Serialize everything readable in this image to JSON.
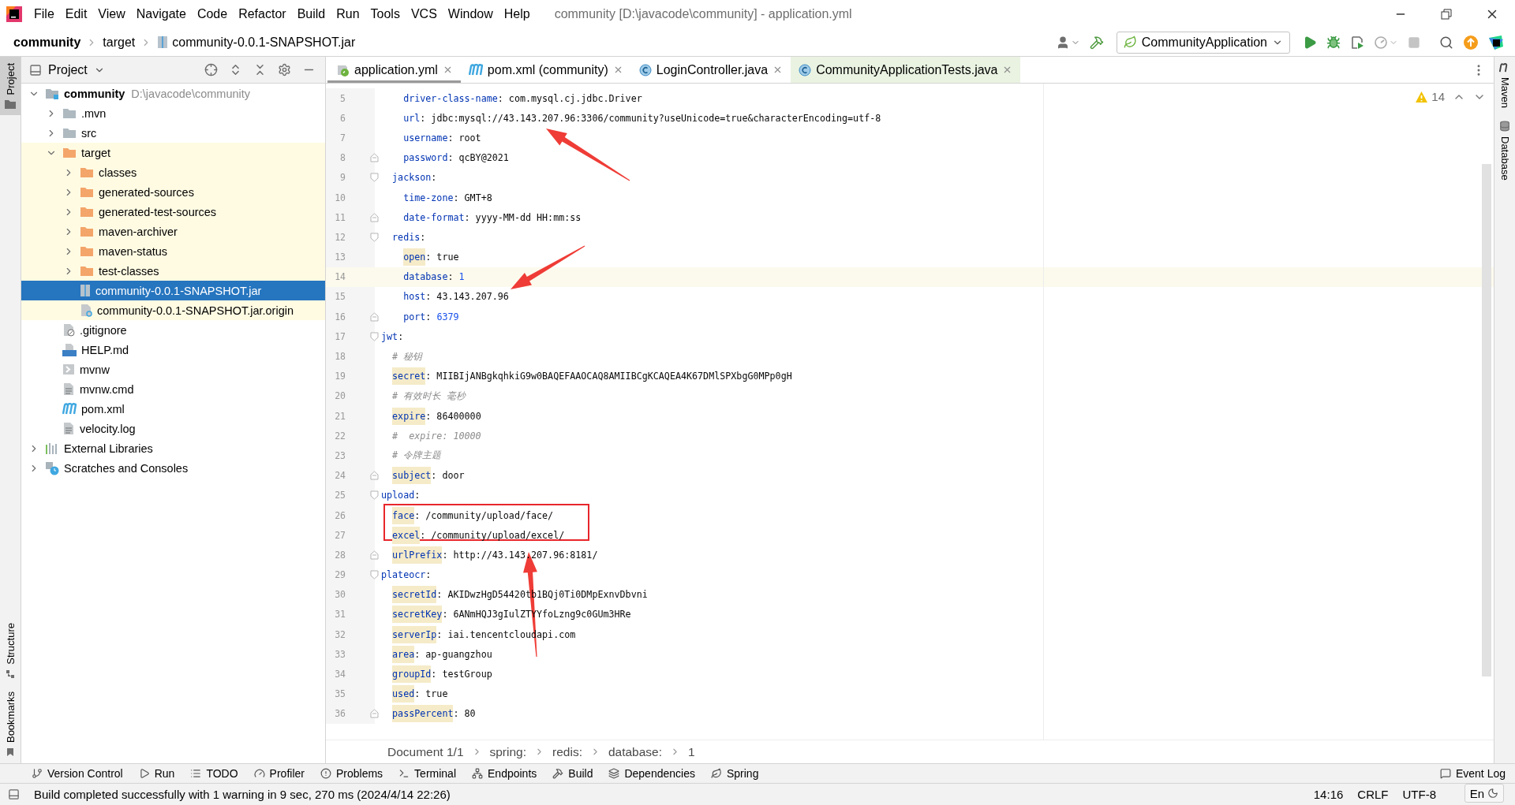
{
  "window": {
    "title": "community [D:\\javacode\\community] - application.yml"
  },
  "menu": [
    "File",
    "Edit",
    "View",
    "Navigate",
    "Code",
    "Refactor",
    "Build",
    "Run",
    "Tools",
    "VCS",
    "Window",
    "Help"
  ],
  "breadcrumbs": [
    "community",
    "target",
    "community-0.0.1-SNAPSHOT.jar"
  ],
  "run_config": {
    "label": "CommunityApplication"
  },
  "left_strip": {
    "top": [
      {
        "label": "Project",
        "selected": true
      }
    ],
    "bottom": [
      {
        "label": "Structure",
        "selected": false
      },
      {
        "label": "Bookmarks",
        "selected": false
      }
    ]
  },
  "project_panel": {
    "title": "Project",
    "tree": [
      {
        "label": "community",
        "path": "D:\\javacode\\community",
        "kind": "module",
        "expanded": true,
        "selected": false,
        "excluded": false,
        "children": [
          {
            "label": ".mvn",
            "kind": "folder",
            "expanded": false,
            "selected": false,
            "excluded": false
          },
          {
            "label": "src",
            "kind": "folder",
            "expanded": false,
            "selected": false,
            "excluded": false
          },
          {
            "label": "target",
            "kind": "folder",
            "expanded": true,
            "selected": false,
            "excluded": true,
            "children": [
              {
                "label": "classes",
                "kind": "folder",
                "expanded": false,
                "selected": false,
                "excluded": true
              },
              {
                "label": "generated-sources",
                "kind": "folder",
                "expanded": false,
                "selected": false,
                "excluded": true
              },
              {
                "label": "generated-test-sources",
                "kind": "folder",
                "expanded": false,
                "selected": false,
                "excluded": true
              },
              {
                "label": "maven-archiver",
                "kind": "folder",
                "expanded": false,
                "selected": false,
                "excluded": true
              },
              {
                "label": "maven-status",
                "kind": "folder",
                "expanded": false,
                "selected": false,
                "excluded": true
              },
              {
                "label": "test-classes",
                "kind": "folder",
                "expanded": false,
                "selected": false,
                "excluded": true
              },
              {
                "label": "community-0.0.1-SNAPSHOT.jar",
                "kind": "jar",
                "selected": true,
                "excluded": true
              },
              {
                "label": "community-0.0.1-SNAPSHOT.jar.origin",
                "kind": "unknown",
                "selected": false,
                "excluded": true
              }
            ]
          },
          {
            "label": ".gitignore",
            "kind": "ignore",
            "selected": false,
            "excluded": false
          },
          {
            "label": "HELP.md",
            "kind": "markdown",
            "selected": false,
            "excluded": false
          },
          {
            "label": "mvnw",
            "kind": "shell",
            "selected": false,
            "excluded": false
          },
          {
            "label": "mvnw.cmd",
            "kind": "text",
            "selected": false,
            "excluded": false
          },
          {
            "label": "pom.xml",
            "kind": "maven",
            "selected": false,
            "excluded": false
          },
          {
            "label": "velocity.log",
            "kind": "text",
            "selected": false,
            "excluded": false
          }
        ]
      },
      {
        "label": "External Libraries",
        "kind": "libraries",
        "expanded": false,
        "selected": false,
        "excluded": false
      },
      {
        "label": "Scratches and Consoles",
        "kind": "scratches",
        "expanded": false,
        "selected": false,
        "excluded": false
      }
    ]
  },
  "tabs": [
    {
      "label": "application.yml",
      "kind": "yaml",
      "selected": true,
      "test": false
    },
    {
      "label": "pom.xml (community)",
      "kind": "maven",
      "selected": false,
      "test": false
    },
    {
      "label": "LoginController.java",
      "kind": "class",
      "selected": false,
      "test": false
    },
    {
      "label": "CommunityApplicationTests.java",
      "kind": "class",
      "selected": false,
      "test": true
    }
  ],
  "editor": {
    "warnings": "14",
    "lines": [
      {
        "number": "5",
        "kind": "deep",
        "fold_open": false,
        "fold_close": false,
        "tokens": [
          {
            "kind": "key",
            "text": "driver-class-name",
            "flagged": false
          },
          {
            "kind": "plain",
            "text": ": com.mysql.cj.jdbc.Driver"
          }
        ]
      },
      {
        "number": "6",
        "kind": "deep",
        "fold_open": false,
        "fold_close": false,
        "tokens": [
          {
            "kind": "key",
            "text": "url",
            "flagged": false
          },
          {
            "kind": "plain",
            "text": ": jdbc:mysql://43.143.207.96:3306/community?useUnicode=true&characterEncoding=utf-8"
          }
        ]
      },
      {
        "number": "7",
        "kind": "deep",
        "fold_open": false,
        "fold_close": false,
        "tokens": [
          {
            "kind": "key",
            "text": "username",
            "flagged": false
          },
          {
            "kind": "plain",
            "text": ": root"
          }
        ]
      },
      {
        "number": "8",
        "kind": "deep",
        "fold_open": false,
        "fold_close": true,
        "tokens": [
          {
            "kind": "key",
            "text": "password",
            "flagged": false
          },
          {
            "kind": "plain",
            "text": ": qcBY@2021"
          }
        ]
      },
      {
        "number": "9",
        "kind": "mid",
        "fold_open": true,
        "fold_close": false,
        "tokens": [
          {
            "kind": "key",
            "text": "jackson",
            "flagged": false
          },
          {
            "kind": "plain",
            "text": ":"
          }
        ]
      },
      {
        "number": "10",
        "kind": "deep",
        "fold_open": false,
        "fold_close": false,
        "tokens": [
          {
            "kind": "key",
            "text": "time-zone",
            "flagged": false
          },
          {
            "kind": "plain",
            "text": ": GMT+8"
          }
        ]
      },
      {
        "number": "11",
        "kind": "deep",
        "fold_open": false,
        "fold_close": true,
        "tokens": [
          {
            "kind": "key",
            "text": "date-format",
            "flagged": false
          },
          {
            "kind": "plain",
            "text": ": yyyy-MM-dd HH:mm:ss"
          }
        ]
      },
      {
        "number": "12",
        "kind": "mid",
        "fold_open": true,
        "fold_close": false,
        "tokens": [
          {
            "kind": "key",
            "text": "redis",
            "flagged": false
          },
          {
            "kind": "plain",
            "text": ":"
          }
        ]
      },
      {
        "number": "13",
        "kind": "deep",
        "fold_open": false,
        "fold_close": false,
        "tokens": [
          {
            "kind": "key",
            "text": "open",
            "flagged": true
          },
          {
            "kind": "plain",
            "text": ": true"
          }
        ]
      },
      {
        "number": "14",
        "kind": "deep",
        "current": true,
        "fold_open": false,
        "fold_close": false,
        "tokens": [
          {
            "kind": "key",
            "text": "database",
            "flagged": false
          },
          {
            "kind": "plain",
            "text": ": "
          },
          {
            "kind": "number",
            "text": "1"
          }
        ]
      },
      {
        "number": "15",
        "kind": "deep",
        "fold_open": false,
        "fold_close": false,
        "tokens": [
          {
            "kind": "key",
            "text": "host",
            "flagged": false
          },
          {
            "kind": "plain",
            "text": ": 43.143.207.96"
          }
        ]
      },
      {
        "number": "16",
        "kind": "deep",
        "fold_open": false,
        "fold_close": true,
        "tokens": [
          {
            "kind": "key",
            "text": "port",
            "flagged": false
          },
          {
            "kind": "plain",
            "text": ": "
          },
          {
            "kind": "number",
            "text": "6379"
          }
        ]
      },
      {
        "number": "17",
        "kind": "top",
        "fold_open": true,
        "fold_close": false,
        "tokens": [
          {
            "kind": "key",
            "text": "jwt",
            "flagged": false
          },
          {
            "kind": "plain",
            "text": ":"
          }
        ]
      },
      {
        "number": "18",
        "kind": "mid",
        "fold_open": false,
        "fold_close": false,
        "tokens": [
          {
            "kind": "comment",
            "text": "# 秘钥"
          }
        ]
      },
      {
        "number": "19",
        "kind": "mid",
        "fold_open": false,
        "fold_close": false,
        "tokens": [
          {
            "kind": "key",
            "text": "secret",
            "flagged": true
          },
          {
            "kind": "plain",
            "text": ": MIIBIjANBgkqhkiG9w0BAQEFAAOCAQ8AMIIBCgKCAQEA4K67DMlSPXbgG0MPp0gH"
          }
        ]
      },
      {
        "number": "20",
        "kind": "mid",
        "fold_open": false,
        "fold_close": false,
        "tokens": [
          {
            "kind": "comment",
            "text": "# 有效时长 毫秒"
          }
        ]
      },
      {
        "number": "21",
        "kind": "mid",
        "fold_open": false,
        "fold_close": false,
        "tokens": [
          {
            "kind": "key",
            "text": "expire",
            "flagged": true
          },
          {
            "kind": "plain",
            "text": ": 86400000"
          }
        ]
      },
      {
        "number": "22",
        "kind": "mid",
        "fold_open": false,
        "fold_close": false,
        "tokens": [
          {
            "kind": "comment",
            "text": "#  expire: 10000"
          }
        ]
      },
      {
        "number": "23",
        "kind": "mid",
        "fold_open": false,
        "fold_close": false,
        "tokens": [
          {
            "kind": "comment",
            "text": "# 令牌主题"
          }
        ]
      },
      {
        "number": "24",
        "kind": "mid",
        "fold_open": false,
        "fold_close": true,
        "tokens": [
          {
            "kind": "key",
            "text": "subject",
            "flagged": true
          },
          {
            "kind": "plain",
            "text": ": door"
          }
        ]
      },
      {
        "number": "25",
        "kind": "top",
        "fold_open": true,
        "fold_close": false,
        "tokens": [
          {
            "kind": "key",
            "text": "upload",
            "flagged": false
          },
          {
            "kind": "plain",
            "text": ":"
          }
        ]
      },
      {
        "number": "26",
        "kind": "mid",
        "fold_open": false,
        "fold_close": false,
        "tokens": [
          {
            "kind": "key",
            "text": "face",
            "flagged": true
          },
          {
            "kind": "plain",
            "text": ": /community/upload/face/"
          }
        ]
      },
      {
        "number": "27",
        "kind": "mid",
        "fold_open": false,
        "fold_close": false,
        "tokens": [
          {
            "kind": "key",
            "text": "excel",
            "flagged": true
          },
          {
            "kind": "plain",
            "text": ": /community/upload/excel/"
          }
        ]
      },
      {
        "number": "28",
        "kind": "mid",
        "fold_open": false,
        "fold_close": true,
        "tokens": [
          {
            "kind": "key",
            "text": "urlPrefix",
            "flagged": true
          },
          {
            "kind": "plain",
            "text": ": http://43.143.207.96:8181/"
          }
        ]
      },
      {
        "number": "29",
        "kind": "top",
        "fold_open": true,
        "fold_close": false,
        "tokens": [
          {
            "kind": "key",
            "text": "plateocr",
            "flagged": false
          },
          {
            "kind": "plain",
            "text": ":"
          }
        ]
      },
      {
        "number": "30",
        "kind": "mid",
        "fold_open": false,
        "fold_close": false,
        "tokens": [
          {
            "kind": "key",
            "text": "secretId",
            "flagged": true
          },
          {
            "kind": "plain",
            "text": ": AKIDwzHgD54420tb1BQj0Ti0DMpExnvDbvni"
          }
        ]
      },
      {
        "number": "31",
        "kind": "mid",
        "fold_open": false,
        "fold_close": false,
        "tokens": [
          {
            "kind": "key",
            "text": "secretKey",
            "flagged": true
          },
          {
            "kind": "plain",
            "text": ": 6ANmHQJ3gIulZTYYfoLzng9c0GUm3HRe"
          }
        ]
      },
      {
        "number": "32",
        "kind": "mid",
        "fold_open": false,
        "fold_close": false,
        "tokens": [
          {
            "kind": "key",
            "text": "serverIp",
            "flagged": true
          },
          {
            "kind": "plain",
            "text": ": iai.tencentcloudapi.com"
          }
        ]
      },
      {
        "number": "33",
        "kind": "mid",
        "fold_open": false,
        "fold_close": false,
        "tokens": [
          {
            "kind": "key",
            "text": "area",
            "flagged": true
          },
          {
            "kind": "plain",
            "text": ": ap-guangzhou"
          }
        ]
      },
      {
        "number": "34",
        "kind": "mid",
        "fold_open": false,
        "fold_close": false,
        "tokens": [
          {
            "kind": "key",
            "text": "groupId",
            "flagged": true
          },
          {
            "kind": "plain",
            "text": ": testGroup"
          }
        ]
      },
      {
        "number": "35",
        "kind": "mid",
        "fold_open": false,
        "fold_close": false,
        "tokens": [
          {
            "kind": "key",
            "text": "used",
            "flagged": true
          },
          {
            "kind": "plain",
            "text": ": true"
          }
        ]
      },
      {
        "number": "36",
        "kind": "mid",
        "fold_open": false,
        "fold_close": true,
        "tokens": [
          {
            "kind": "key",
            "text": "passPercent",
            "flagged": true
          },
          {
            "kind": "plain",
            "text": ": 80"
          }
        ]
      }
    ]
  },
  "editor_breadcrumbs": [
    "Document 1/1",
    "spring:",
    "redis:",
    "database:",
    "1"
  ],
  "right_strip": [
    {
      "label": "Maven",
      "kind": "maven"
    },
    {
      "label": "Database",
      "kind": "database"
    }
  ],
  "tool_windows": [
    {
      "label": "Version Control",
      "kind": "vcs"
    },
    {
      "label": "Run",
      "kind": "run"
    },
    {
      "label": "TODO",
      "kind": "todo"
    },
    {
      "label": "Profiler",
      "kind": "profiler"
    },
    {
      "label": "Problems",
      "kind": "problems"
    },
    {
      "label": "Terminal",
      "kind": "terminal"
    },
    {
      "label": "Endpoints",
      "kind": "endpoints"
    },
    {
      "label": "Build",
      "kind": "build"
    },
    {
      "label": "Dependencies",
      "kind": "dependencies"
    },
    {
      "label": "Spring",
      "kind": "spring"
    }
  ],
  "event_log": "Event Log",
  "status": {
    "message": "Build completed successfully with 1 warning in 9 sec, 270 ms (2024/4/14 22:26)",
    "position": "14:16",
    "line_ending": "CRLF",
    "encoding": "UTF-8"
  },
  "ime": {
    "label": "En"
  }
}
